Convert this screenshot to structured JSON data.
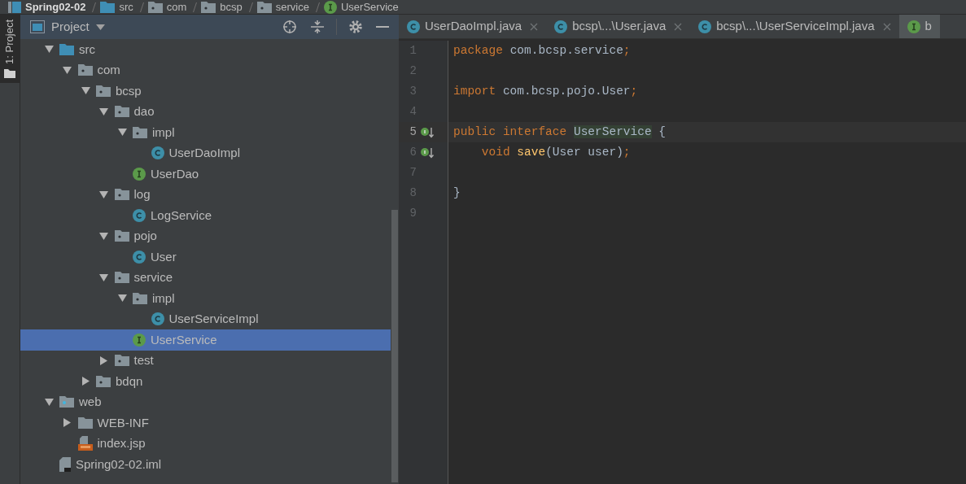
{
  "breadcrumb": [
    {
      "label": "Spring02-02",
      "kind": "module"
    },
    {
      "label": "src",
      "kind": "source"
    },
    {
      "label": "com",
      "kind": "package"
    },
    {
      "label": "bcsp",
      "kind": "package"
    },
    {
      "label": "service",
      "kind": "package"
    },
    {
      "label": "UserService",
      "kind": "interface"
    }
  ],
  "side_tab": {
    "label": "1: Project",
    "selected": true
  },
  "project_panel": {
    "title": "Project"
  },
  "tree": [
    {
      "label": "src",
      "kind": "source",
      "expanded": true,
      "selected": false,
      "children": [
        {
          "label": "com",
          "kind": "package",
          "expanded": true,
          "selected": false,
          "children": [
            {
              "label": "bcsp",
              "kind": "package",
              "expanded": true,
              "selected": false,
              "children": [
                {
                  "label": "dao",
                  "kind": "package",
                  "expanded": true,
                  "selected": false,
                  "children": [
                    {
                      "label": "impl",
                      "kind": "package",
                      "expanded": true,
                      "selected": false,
                      "children": [
                        {
                          "label": "UserDaoImpl",
                          "kind": "class",
                          "selected": false
                        }
                      ]
                    },
                    {
                      "label": "UserDao",
                      "kind": "interface",
                      "selected": false
                    }
                  ]
                },
                {
                  "label": "log",
                  "kind": "package",
                  "expanded": true,
                  "selected": false,
                  "children": [
                    {
                      "label": "LogService",
                      "kind": "class",
                      "selected": false
                    }
                  ]
                },
                {
                  "label": "pojo",
                  "kind": "package",
                  "expanded": true,
                  "selected": false,
                  "children": [
                    {
                      "label": "User",
                      "kind": "class",
                      "selected": false
                    }
                  ]
                },
                {
                  "label": "service",
                  "kind": "package",
                  "expanded": true,
                  "selected": false,
                  "children": [
                    {
                      "label": "impl",
                      "kind": "package",
                      "expanded": true,
                      "selected": false,
                      "children": [
                        {
                          "label": "UserServiceImpl",
                          "kind": "class",
                          "selected": false
                        }
                      ]
                    },
                    {
                      "label": "UserService",
                      "kind": "interface",
                      "selected": true
                    }
                  ]
                },
                {
                  "label": "test",
                  "kind": "package",
                  "expanded": false,
                  "selected": false
                }
              ]
            },
            {
              "label": "bdqn",
              "kind": "package",
              "expanded": false,
              "selected": false
            }
          ]
        }
      ]
    },
    {
      "label": "web",
      "kind": "web",
      "expanded": true,
      "selected": false,
      "children": [
        {
          "label": "WEB-INF",
          "kind": "folder",
          "expanded": false,
          "selected": false
        },
        {
          "label": "index.jsp",
          "kind": "jsp",
          "selected": false
        }
      ]
    },
    {
      "label": "Spring02-02.iml",
      "kind": "iml",
      "selected": false
    }
  ],
  "tabs": [
    {
      "label": "UserDaoImpl.java",
      "kind": "class",
      "selected": false,
      "closable": true
    },
    {
      "label": "bcsp\\...\\User.java",
      "kind": "class",
      "selected": false,
      "closable": true
    },
    {
      "label": "bcsp\\...\\UserServiceImpl.java",
      "kind": "class",
      "selected": false,
      "closable": true
    },
    {
      "label": "b",
      "kind": "interface",
      "selected": true,
      "closable": false
    }
  ],
  "code": [
    {
      "number": "1",
      "current": false,
      "marker": false,
      "tokens": [
        {
          "text": "package ",
          "kind": "keyword"
        },
        {
          "text": "com.bcsp.service",
          "kind": "plain"
        },
        {
          "text": ";",
          "kind": "keyword"
        }
      ]
    },
    {
      "number": "2",
      "current": false,
      "marker": false
    },
    {
      "number": "3",
      "current": false,
      "marker": false,
      "tokens": [
        {
          "text": "import ",
          "kind": "keyword"
        },
        {
          "text": "com.bcsp.pojo.User",
          "kind": "plain"
        },
        {
          "text": ";",
          "kind": "keyword"
        }
      ]
    },
    {
      "number": "4",
      "current": false,
      "marker": false
    },
    {
      "number": "5",
      "current": true,
      "marker": true,
      "tokens": [
        {
          "text": "public interface ",
          "kind": "keyword"
        },
        {
          "text": "UserService",
          "kind": "match"
        },
        {
          "text": " {",
          "kind": "plain"
        }
      ]
    },
    {
      "number": "6",
      "current": false,
      "marker": true,
      "tokens": [
        {
          "text": "    void ",
          "kind": "keyword"
        },
        {
          "text": "save",
          "kind": "method"
        },
        {
          "text": "(User user)",
          "kind": "plain"
        },
        {
          "text": ";",
          "kind": "keyword"
        }
      ]
    },
    {
      "number": "7",
      "current": false,
      "marker": false
    },
    {
      "number": "8",
      "current": false,
      "marker": false,
      "tokens": [
        {
          "text": "}",
          "kind": "plain"
        }
      ]
    },
    {
      "number": "9",
      "current": false,
      "marker": false
    }
  ]
}
